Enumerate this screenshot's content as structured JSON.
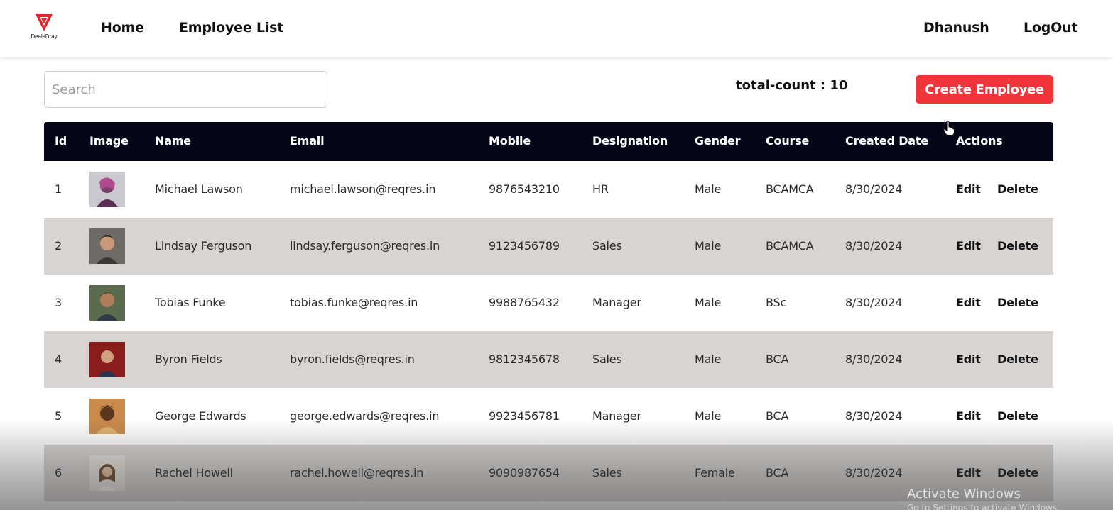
{
  "nav": {
    "logo_text": "DealsDray",
    "home": "Home",
    "employee_list": "Employee List",
    "user": "Dhanush",
    "logout": "LogOut"
  },
  "search": {
    "placeholder": "Search"
  },
  "total_count": "total-count : 10",
  "create_button": "Create Employee",
  "colors": {
    "brand_red": "#f0353a",
    "header_bg": "#040618",
    "row_alt": "#d7d4d2"
  },
  "table": {
    "headers": {
      "id": "Id",
      "image": "Image",
      "name": "Name",
      "email": "Email",
      "mobile": "Mobile",
      "designation": "Designation",
      "gender": "Gender",
      "course": "Course",
      "created_date": "Created Date",
      "actions": "Actions"
    },
    "rows": [
      {
        "id": "1",
        "name": "Michael Lawson",
        "email": "michael.lawson@reqres.in",
        "mobile": "9876543210",
        "designation": "HR",
        "gender": "Male",
        "course": "BCAMCA",
        "created_date": "8/30/2024",
        "edit": "Edit",
        "delete": "Delete"
      },
      {
        "id": "2",
        "name": "Lindsay Ferguson",
        "email": "lindsay.ferguson@reqres.in",
        "mobile": "9123456789",
        "designation": "Sales",
        "gender": "Male",
        "course": "BCAMCA",
        "created_date": "8/30/2024",
        "edit": "Edit",
        "delete": "Delete"
      },
      {
        "id": "3",
        "name": "Tobias Funke",
        "email": "tobias.funke@reqres.in",
        "mobile": "9988765432",
        "designation": "Manager",
        "gender": "Male",
        "course": "BSc",
        "created_date": "8/30/2024",
        "edit": "Edit",
        "delete": "Delete"
      },
      {
        "id": "4",
        "name": "Byron Fields",
        "email": "byron.fields@reqres.in",
        "mobile": "9812345678",
        "designation": "Sales",
        "gender": "Male",
        "course": "BCA",
        "created_date": "8/30/2024",
        "edit": "Edit",
        "delete": "Delete"
      },
      {
        "id": "5",
        "name": "George Edwards",
        "email": "george.edwards@reqres.in",
        "mobile": "9923456781",
        "designation": "Manager",
        "gender": "Male",
        "course": "BCA",
        "created_date": "8/30/2024",
        "edit": "Edit",
        "delete": "Delete"
      },
      {
        "id": "6",
        "name": "Rachel Howell",
        "email": "rachel.howell@reqres.in",
        "mobile": "9090987654",
        "designation": "Sales",
        "gender": "Female",
        "course": "BCA",
        "created_date": "8/30/2024",
        "edit": "Edit",
        "delete": "Delete"
      }
    ]
  },
  "watermark": {
    "title": "Activate Windows",
    "subtitle": "Go to Settings to activate Windows."
  }
}
